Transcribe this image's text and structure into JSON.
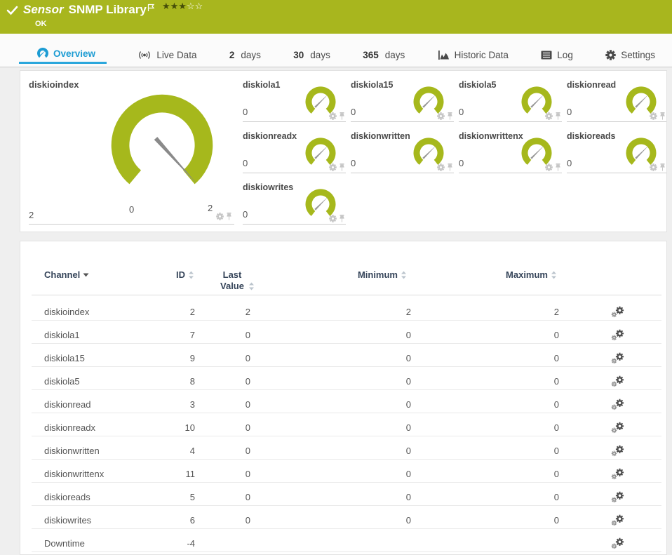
{
  "header": {
    "kind_label": "Sensor",
    "title": "SNMP Library",
    "status": "OK",
    "rating": {
      "filled": 3,
      "total": 5
    },
    "bar_color": "#a8b61e"
  },
  "tabs": [
    {
      "label": "Overview",
      "icon": "gauge-icon",
      "active": true
    },
    {
      "label": "Live Data",
      "icon": "live-data-icon"
    },
    {
      "num": "2",
      "label": "days"
    },
    {
      "num": "30",
      "label": "days"
    },
    {
      "num": "365",
      "label": "days"
    },
    {
      "label": "Historic Data",
      "icon": "area-chart-icon"
    },
    {
      "label": "Log",
      "icon": "log-icon"
    },
    {
      "label": "Settings",
      "icon": "gear-icon"
    }
  ],
  "gauges": {
    "accent_color": "#a6b81c",
    "main": {
      "name": "diskioindex",
      "value": "2",
      "scale_min": "0",
      "scale_max": "2"
    },
    "small": [
      {
        "name": "diskiola1",
        "value": "0"
      },
      {
        "name": "diskiola15",
        "value": "0"
      },
      {
        "name": "diskiola5",
        "value": "0"
      },
      {
        "name": "diskionread",
        "value": "0"
      },
      {
        "name": "diskionreadx",
        "value": "0"
      },
      {
        "name": "diskionwritten",
        "value": "0"
      },
      {
        "name": "diskionwrittenx",
        "value": "0"
      },
      {
        "name": "diskioreads",
        "value": "0"
      },
      {
        "name": "diskiowrites",
        "value": "0"
      }
    ]
  },
  "table": {
    "columns": {
      "channel": "Channel",
      "id": "ID",
      "last": "Last Value",
      "min": "Minimum",
      "max": "Maximum"
    },
    "rows": [
      {
        "channel": "diskioindex",
        "id": "2",
        "last": "2",
        "min": "2",
        "max": "2"
      },
      {
        "channel": "diskiola1",
        "id": "7",
        "last": "0",
        "min": "0",
        "max": "0"
      },
      {
        "channel": "diskiola15",
        "id": "9",
        "last": "0",
        "min": "0",
        "max": "0"
      },
      {
        "channel": "diskiola5",
        "id": "8",
        "last": "0",
        "min": "0",
        "max": "0"
      },
      {
        "channel": "diskionread",
        "id": "3",
        "last": "0",
        "min": "0",
        "max": "0"
      },
      {
        "channel": "diskionreadx",
        "id": "10",
        "last": "0",
        "min": "0",
        "max": "0"
      },
      {
        "channel": "diskionwritten",
        "id": "4",
        "last": "0",
        "min": "0",
        "max": "0"
      },
      {
        "channel": "diskionwrittenx",
        "id": "11",
        "last": "0",
        "min": "0",
        "max": "0"
      },
      {
        "channel": "diskioreads",
        "id": "5",
        "last": "0",
        "min": "0",
        "max": "0"
      },
      {
        "channel": "diskiowrites",
        "id": "6",
        "last": "0",
        "min": "0",
        "max": "0"
      },
      {
        "channel": "Downtime",
        "id": "-4",
        "last": "",
        "min": "",
        "max": ""
      }
    ]
  }
}
